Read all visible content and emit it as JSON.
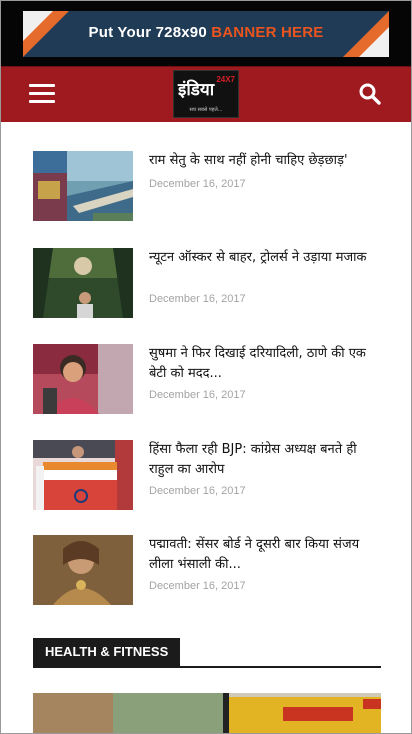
{
  "ad": {
    "text_main": "Put Your 728x90 ",
    "text_highlight": "BANNER HERE"
  },
  "header": {
    "logo_text": "इंडिया",
    "logo_number": "24X7",
    "logo_tagline": "सच सबसे पहले...",
    "menu_icon": "hamburger-menu-icon",
    "search_icon": "search-icon"
  },
  "articles": [
    {
      "title": "राम सेतु के साथ नहीं होनी चाहिए छेड़छाड़'",
      "date": "December 16, 2017"
    },
    {
      "title": "न्यूटन ऑस्कर से बाहर, ट्रोलर्स ने उड़ाया मजाक",
      "date": "December 16, 2017"
    },
    {
      "title": "सुषमा ने फिर दिखाई दरियादिली, ठाणे की एक बेटी को मदद...",
      "date": "December 16, 2017"
    },
    {
      "title": "हिंसा फैला रही BJP: कांग्रेस अध्यक्ष बनते ही राहुल का आरोप",
      "date": "December 16, 2017"
    },
    {
      "title": "पद्मावती: सेंसर बोर्ड ने दूसरी बार किया संजय लीला भंसाली की...",
      "date": "December 16, 2017"
    }
  ],
  "section": {
    "label": "HEALTH & FITNESS"
  },
  "colors": {
    "header_bg": "#9e1a1f",
    "ad_bg": "#1f3b56",
    "ad_accent": "#e9541f",
    "date_text": "#a3a3a3",
    "section_bg": "#1b1b1b"
  }
}
